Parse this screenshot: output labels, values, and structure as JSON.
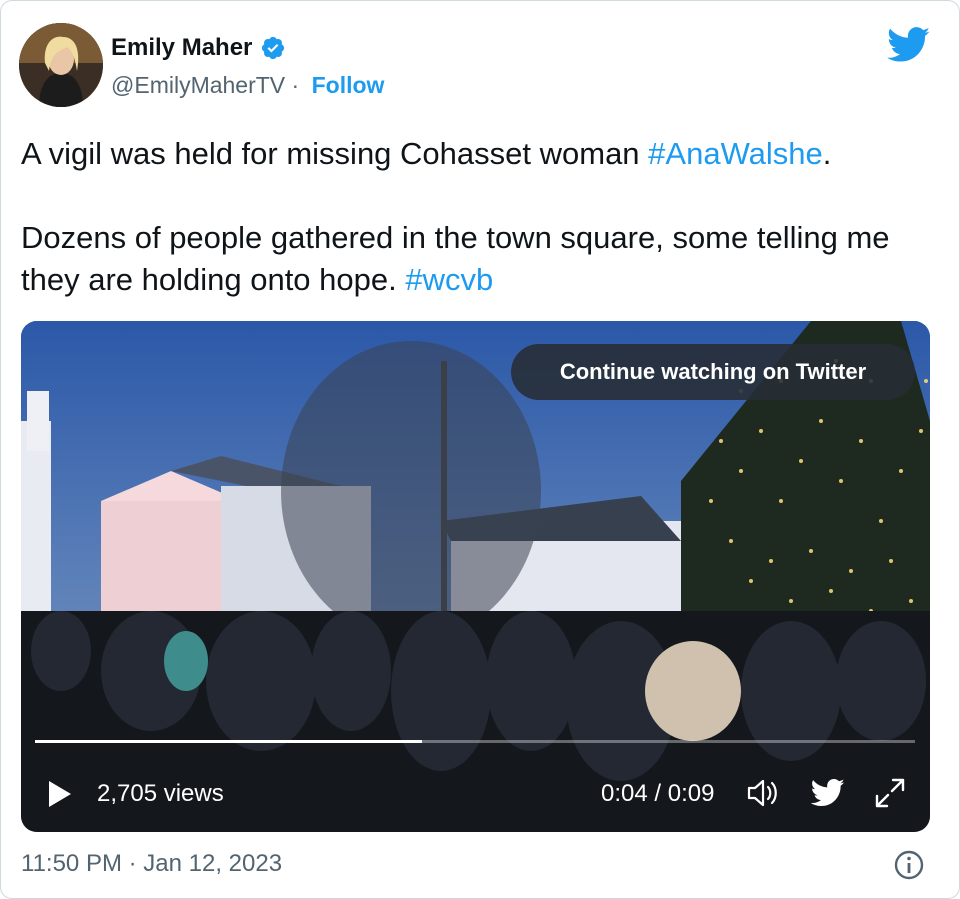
{
  "author": {
    "name": "Emily Maher",
    "handle": "@EmilyMaherTV",
    "separator": " · ",
    "follow_label": "Follow"
  },
  "tweet": {
    "line1_prefix": "A vigil was held for missing Cohasset woman ",
    "line1_hashtag": "#AnaWalshe",
    "line1_suffix": ".",
    "line2_prefix": "Dozens of people gathered in the town square, some telling me they are holding onto hope. ",
    "line2_hashtag": "#wcvb"
  },
  "video": {
    "continue_label": "Continue watching on Twitter",
    "views": "2,705 views",
    "time": "0:04 / 0:09",
    "progress_fraction": 0.44
  },
  "footer": {
    "timestamp": "11:50 PM · Jan 12, 2023"
  },
  "colors": {
    "accent": "#1d9bf0",
    "text": "#0f1419",
    "muted": "#536471"
  },
  "icons": {
    "verified": "verified-badge-icon",
    "twitter": "twitter-bird-icon",
    "play": "play-icon",
    "volume": "volume-icon",
    "fullscreen": "fullscreen-icon",
    "info": "info-icon"
  }
}
